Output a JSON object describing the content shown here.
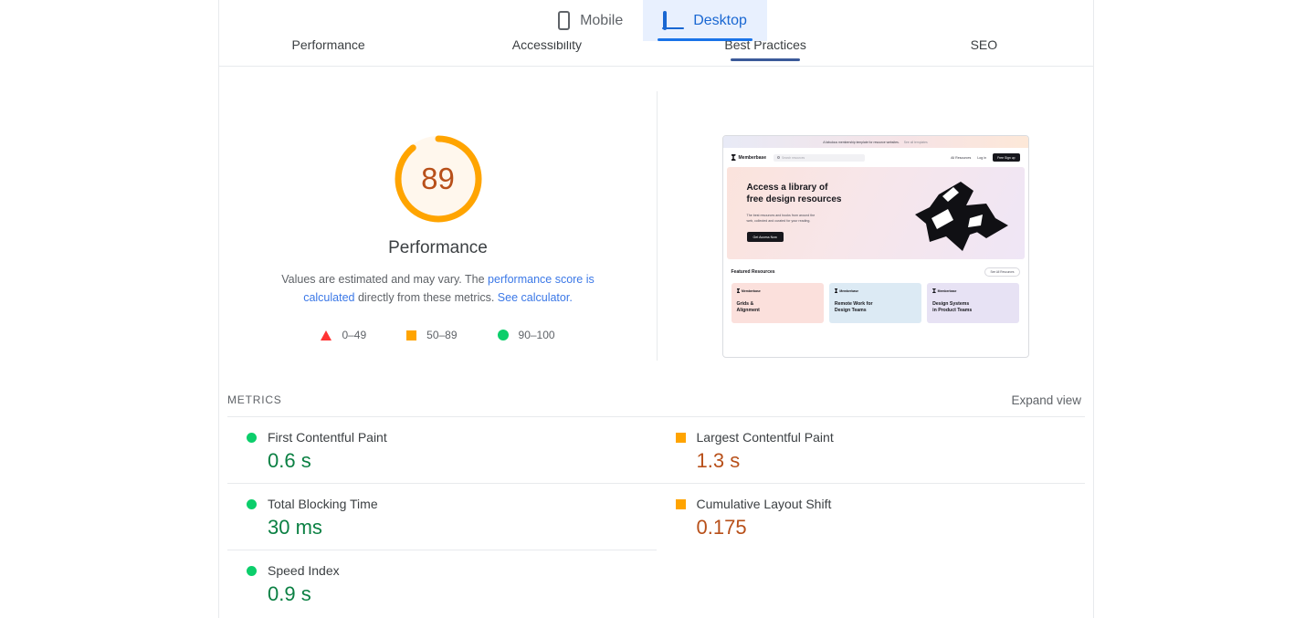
{
  "form_factor": {
    "mobile": {
      "label": "Mobile",
      "icon": "mobile-phone-icon",
      "selected": false
    },
    "desktop": {
      "label": "Desktop",
      "icon": "desktop-monitor-icon",
      "selected": true
    }
  },
  "category_tabs": [
    {
      "label": "Performance",
      "active": false
    },
    {
      "label": "Accessibility",
      "active": false
    },
    {
      "label": "Best Practices",
      "active": true
    },
    {
      "label": "SEO",
      "active": false
    }
  ],
  "score": {
    "value": "89",
    "value_number": 89,
    "title": "Performance",
    "ring_color": "#ffa400",
    "text_color": "#b8501a",
    "description_pre": "Values are estimated and may vary. The ",
    "description_link1": "performance score is calculated",
    "description_mid": " directly from these metrics. ",
    "description_link2": "See calculator.",
    "legend": [
      {
        "range": "0–49",
        "shape": "triangle",
        "color": "#ff3333",
        "icon": "legend-triangle-icon"
      },
      {
        "range": "50–89",
        "shape": "square",
        "color": "#ffa400",
        "icon": "legend-square-icon"
      },
      {
        "range": "90–100",
        "shape": "circle",
        "color": "#0cce6b",
        "icon": "legend-circle-icon"
      }
    ]
  },
  "screenshot": {
    "banner_text": "A fabulous membership template for resource websites.",
    "banner_link": "See all templates",
    "brand": "Memberbase",
    "search_placeholder": "Search resources",
    "nav_links": [
      "All Resources",
      "Log in"
    ],
    "nav_cta": "Free Sign up",
    "hero_title_line1": "Access a library of",
    "hero_title_line2": "free design resources",
    "hero_sub_line1": "The best resources and books from around the",
    "hero_sub_line2": "web, collected and curated for your reading.",
    "hero_cta": "Get Access Now",
    "featured_title": "Featured Resources",
    "featured_action": "See All Resources",
    "cards": [
      {
        "brand": "Memberbase",
        "title_line1": "Grids &",
        "title_line2": "Alignment",
        "bg": "#fbe0dc"
      },
      {
        "brand": "Memberbase",
        "title_line1": "Remote Work for",
        "title_line2": "Design Teams",
        "bg": "#dceaf4"
      },
      {
        "brand": "Memberbase",
        "title_line1": "Design Systems",
        "title_line2": "in Product Teams",
        "bg": "#e7e2f4"
      }
    ]
  },
  "metrics": {
    "heading": "METRICS",
    "expand_view": "Expand view",
    "left": [
      {
        "name": "First Contentful Paint",
        "value": "0.6 s",
        "status": "pass",
        "marker": "circle"
      },
      {
        "name": "Total Blocking Time",
        "value": "30 ms",
        "status": "pass",
        "marker": "circle"
      },
      {
        "name": "Speed Index",
        "value": "0.9 s",
        "status": "pass",
        "marker": "circle"
      }
    ],
    "right": [
      {
        "name": "Largest Contentful Paint",
        "value": "1.3 s",
        "status": "average",
        "marker": "square"
      },
      {
        "name": "Cumulative Layout Shift",
        "value": "0.175",
        "status": "average",
        "marker": "square"
      }
    ]
  }
}
